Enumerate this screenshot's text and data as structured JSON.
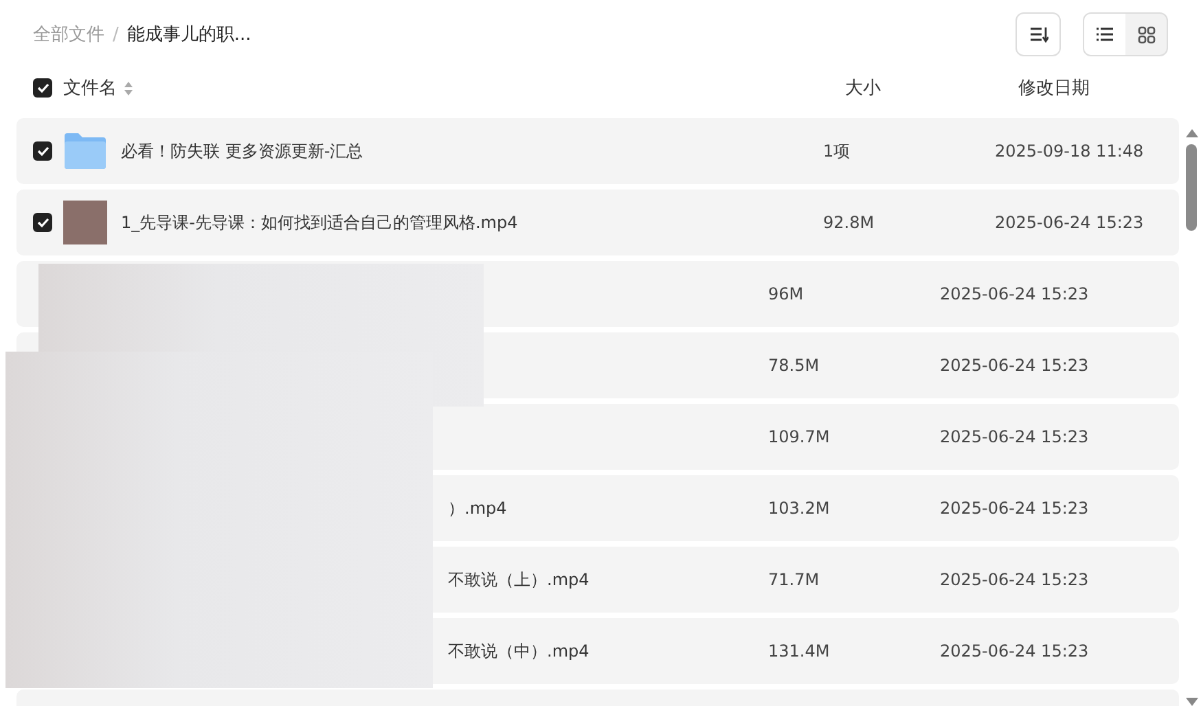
{
  "breadcrumb_separator": "/",
  "breadcrumb": [
    {
      "label": "全部文件",
      "current": false
    },
    {
      "label": "能成事儿的职...",
      "current": true
    }
  ],
  "view_modes": [
    {
      "kind": "list",
      "selected": true
    },
    {
      "kind": "grid",
      "selected": false
    }
  ],
  "columns": {
    "all_checked": true,
    "name": "文件名",
    "size": "大小",
    "date": "修改日期"
  },
  "rows": [
    {
      "kind": "folder",
      "checked": true,
      "name": "必看！防失联 更多资源更新-汇总",
      "size": "1项",
      "date": "2025-09-18 11:48"
    },
    {
      "kind": "video",
      "checked": true,
      "name": "1_先导课-先导课：如何找到适合自己的管理风格.mp4",
      "size": "92.8M",
      "date": "2025-06-24 15:23"
    },
    {
      "kind": "hidden",
      "size": "96M",
      "date": "2025-06-24 15:23"
    },
    {
      "kind": "hidden",
      "size": "78.5M",
      "date": "2025-06-24 15:23"
    },
    {
      "kind": "hidden",
      "size": "109.7M",
      "date": "2025-06-24 15:23"
    },
    {
      "kind": "hidden",
      "name": "）.mp4",
      "size": "103.2M",
      "date": "2025-06-24 15:23"
    },
    {
      "kind": "hidden",
      "name": "不敢说（上）.mp4",
      "size": "71.7M",
      "date": "2025-06-24 15:23"
    },
    {
      "kind": "hidden",
      "name": "不敢说（中）.mp4",
      "size": "131.4M",
      "date": "2025-06-24 15:23"
    }
  ]
}
